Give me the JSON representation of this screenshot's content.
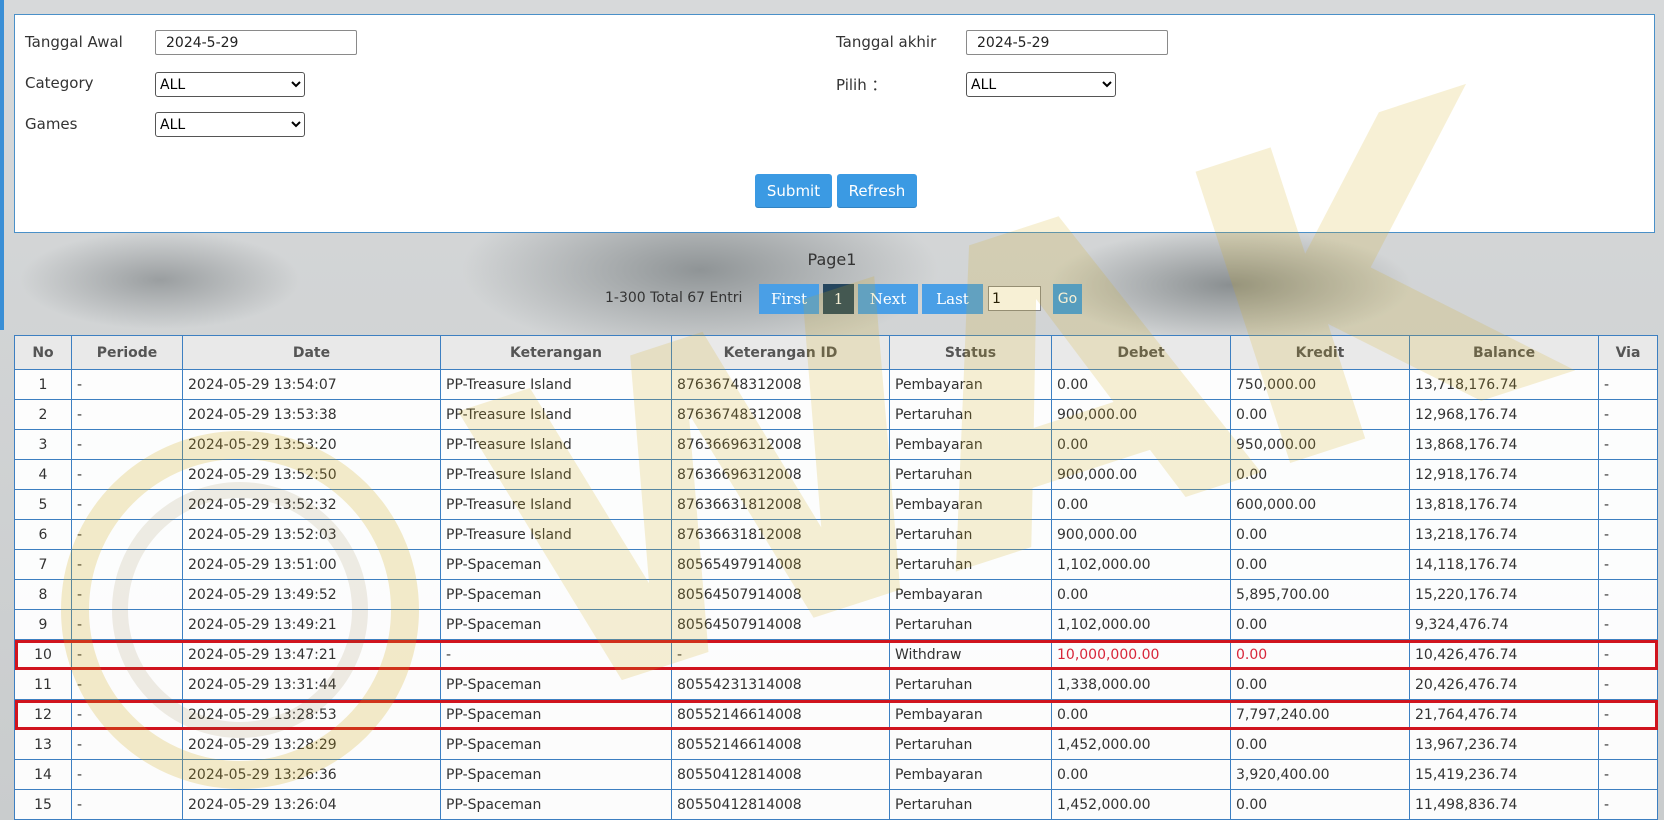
{
  "filters": {
    "start_date_label": "Tanggal Awal",
    "start_date_value": "2024-5-29",
    "end_date_label": "Tanggal akhir",
    "end_date_value": "2024-5-29",
    "category_label": "Category",
    "category_value": "ALL",
    "choose_label": "Pilih ：",
    "choose_value": "ALL",
    "games_label": "Games",
    "games_value": "ALL",
    "submit_label": "Submit",
    "refresh_label": "Refresh"
  },
  "pagination": {
    "page_title": "Page1",
    "summary": "1-300 Total 67 Entri",
    "first_label": "First",
    "current_page": "1",
    "next_label": "Next",
    "last_label": "Last",
    "page_input_value": "1",
    "go_label": "Go"
  },
  "table": {
    "headers": [
      "No",
      "Periode",
      "Date",
      "Keterangan",
      "Keterangan ID",
      "Status",
      "Debet",
      "Kredit",
      "Balance",
      "Via"
    ],
    "rows": [
      [
        "1",
        "-",
        "2024-05-29 13:54:07",
        "PP-Treasure Island",
        "87636748312008",
        "Pembayaran",
        "0.00",
        "750,000.00",
        "13,718,176.74",
        "-"
      ],
      [
        "2",
        "-",
        "2024-05-29 13:53:38",
        "PP-Treasure Island",
        "87636748312008",
        "Pertaruhan",
        "900,000.00",
        "0.00",
        "12,968,176.74",
        "-"
      ],
      [
        "3",
        "-",
        "2024-05-29 13:53:20",
        "PP-Treasure Island",
        "87636696312008",
        "Pembayaran",
        "0.00",
        "950,000.00",
        "13,868,176.74",
        "-"
      ],
      [
        "4",
        "-",
        "2024-05-29 13:52:50",
        "PP-Treasure Island",
        "87636696312008",
        "Pertaruhan",
        "900,000.00",
        "0.00",
        "12,918,176.74",
        "-"
      ],
      [
        "5",
        "-",
        "2024-05-29 13:52:32",
        "PP-Treasure Island",
        "87636631812008",
        "Pembayaran",
        "0.00",
        "600,000.00",
        "13,818,176.74",
        "-"
      ],
      [
        "6",
        "-",
        "2024-05-29 13:52:03",
        "PP-Treasure Island",
        "87636631812008",
        "Pertaruhan",
        "900,000.00",
        "0.00",
        "13,218,176.74",
        "-"
      ],
      [
        "7",
        "-",
        "2024-05-29 13:51:00",
        "PP-Spaceman",
        "80565497914008",
        "Pertaruhan",
        "1,102,000.00",
        "0.00",
        "14,118,176.74",
        "-"
      ],
      [
        "8",
        "-",
        "2024-05-29 13:49:52",
        "PP-Spaceman",
        "80564507914008",
        "Pembayaran",
        "0.00",
        "5,895,700.00",
        "15,220,176.74",
        "-"
      ],
      [
        "9",
        "-",
        "2024-05-29 13:49:21",
        "PP-Spaceman",
        "80564507914008",
        "Pertaruhan",
        "1,102,000.00",
        "0.00",
        "9,324,476.74",
        "-"
      ],
      [
        "10",
        "-",
        "2024-05-29 13:47:21",
        "-",
        "-",
        "Withdraw",
        "10,000,000.00",
        "0.00",
        "10,426,476.74",
        "-"
      ],
      [
        "11",
        "-",
        "2024-05-29 13:31:44",
        "PP-Spaceman",
        "80554231314008",
        "Pertaruhan",
        "1,338,000.00",
        "0.00",
        "20,426,476.74",
        "-"
      ],
      [
        "12",
        "-",
        "2024-05-29 13:28:53",
        "PP-Spaceman",
        "80552146614008",
        "Pembayaran",
        "0.00",
        "7,797,240.00",
        "21,764,476.74",
        "-"
      ],
      [
        "13",
        "-",
        "2024-05-29 13:28:29",
        "PP-Spaceman",
        "80552146614008",
        "Pertaruhan",
        "1,452,000.00",
        "0.00",
        "13,967,236.74",
        "-"
      ],
      [
        "14",
        "-",
        "2024-05-29 13:26:36",
        "PP-Spaceman",
        "80550412814008",
        "Pembayaran",
        "0.00",
        "3,920,400.00",
        "15,419,236.74",
        "-"
      ],
      [
        "15",
        "-",
        "2024-05-29 13:26:04",
        "PP-Spaceman",
        "80550412814008",
        "Pertaruhan",
        "1,452,000.00",
        "0.00",
        "11,498,836.74",
        "-"
      ]
    ],
    "red_text_row": "10",
    "highlighted_rows": [
      "10",
      "12"
    ],
    "highlight_color": "#d0141e",
    "red_text_color": "#d8263a"
  },
  "watermark": {
    "text": "WAK",
    "color": "#d2aa14"
  }
}
